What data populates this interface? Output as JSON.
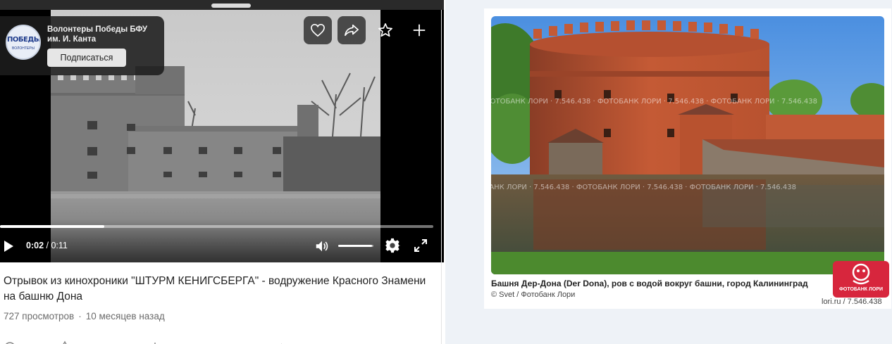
{
  "channel": {
    "name": "Волонтеры Победы БФУ им. И. Канта",
    "avatar_text": "ПОБЕДЫ",
    "avatar_sub": "ВОЛОНТЕРЫ",
    "subscribe_label": "Подписаться"
  },
  "player": {
    "current_time": "0:02",
    "duration": " / 0:11",
    "progress": 0.24,
    "volume": 0.95
  },
  "video": {
    "title": "Отрывок из кинохроники \"ШТУРМ КЕНИГСБЕРГА\" - водружение Красного Знамени на башню Дона",
    "views": "727 просмотров",
    "age": "10 месяцев назад"
  },
  "photo": {
    "caption": "Башня Дер-Дона (Der Dona), ров с водой вокруг башни,  город Калининград",
    "credit": "© Svet / Фотобанк Лори",
    "id": "lori.ru / 7.546.438",
    "watermark": "ФОТОБАНК ЛОРИ · 7.546.438 · ФОТОБАНК ЛОРИ · 7.546.438 · ФОТОБАНК ЛОРИ · 7.546.438",
    "badge": "ФОТОБАНК ЛОРИ"
  },
  "colors": {
    "accent_red": "#d7263d",
    "page_bg": "#eef2f7"
  }
}
